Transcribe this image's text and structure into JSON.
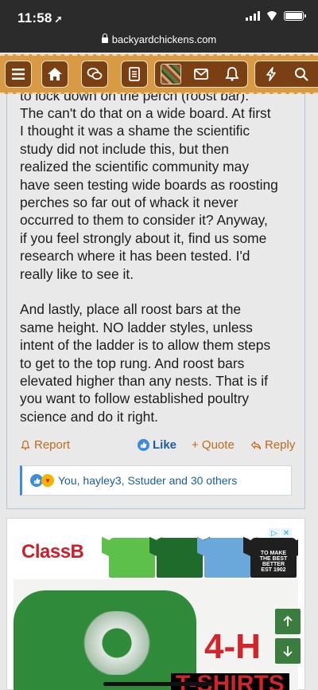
{
  "status_bar": {
    "time": "11:58"
  },
  "browser": {
    "url": "backyardchickens.com"
  },
  "nav": {
    "icons": [
      "menu-icon",
      "home-icon",
      "chat-bubbles-icon",
      "document-icon",
      "avatar",
      "mail-icon",
      "bell-icon",
      "lightning-icon",
      "search-icon"
    ],
    "accent": "#d99a46",
    "button_color": "#7a3f12"
  },
  "post": {
    "lines": [
      "to lock down on the perch (roost bar).",
      "The can't do that on a wide board. At first",
      "I thought it was a shame the scientific",
      "study did not include this, but then",
      "realized the scientific community may",
      "have seen testing wide boards as roosting",
      "perches so far out of whack it never",
      "occurred to them to consider it? Anyway,",
      "if you feel strongly about it, find us some",
      "research where it has been tested. I'd",
      "really like to see it."
    ],
    "lines2": [
      "And lastly, place all roost bars at the",
      "same height. NO ladder styles, unless",
      "intent of the ladder is to allow them steps",
      "to get to the top rung. And roost bars",
      "elevated higher than any nests. That is if",
      "you want to follow established poultry",
      "science and do it right."
    ],
    "actions": {
      "report": "Report",
      "like": "Like",
      "quote": "+ Quote",
      "reply": "Reply"
    },
    "reactions_text": "You, hayley3, Sstuder and 30 others"
  },
  "ad": {
    "brand": "ClassB",
    "badge": [
      "▷",
      "✕"
    ],
    "shirt_text": "TO MAKE THE BEST BETTER EST 1902",
    "hero_title": "4-H",
    "hero_sub": "T-SHIRTS"
  }
}
